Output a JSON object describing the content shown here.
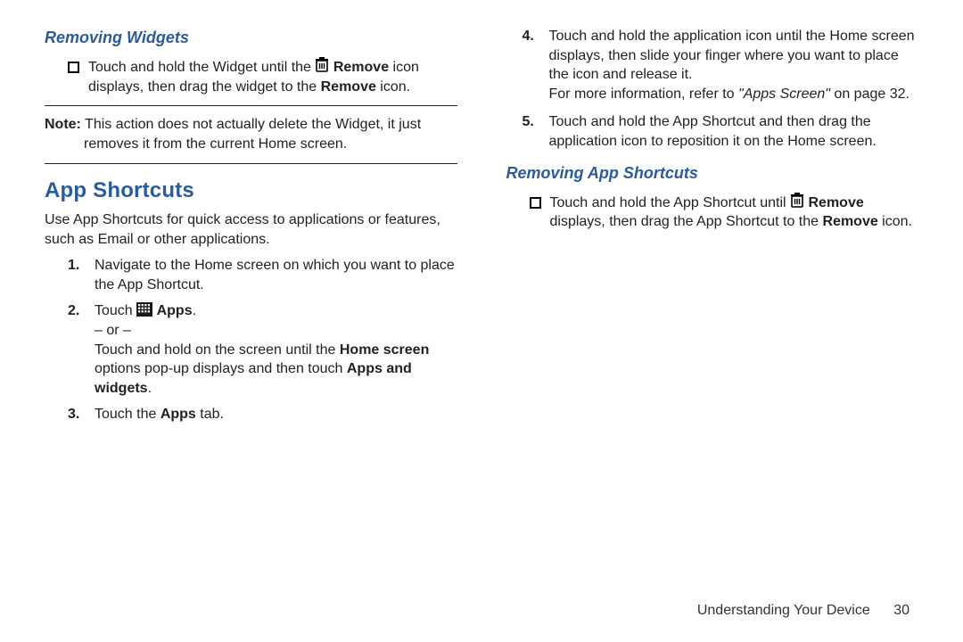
{
  "left": {
    "subheading1": "Removing Widgets",
    "bullet1_pre": "Touch and hold the Widget until the ",
    "bullet1_remove": "Remove",
    "bullet1_mid": " icon displays, then drag the widget to the ",
    "bullet1_remove2": "Remove",
    "bullet1_end": " icon.",
    "note_label": "Note:",
    "note_text_line1": " This action does not actually delete the Widget, it just",
    "note_text_line2": "removes it from the current Home screen.",
    "heading": "App Shortcuts",
    "intro": "Use App Shortcuts for quick access to applications or features, such as Email or other applications.",
    "step1_num": "1.",
    "step1": "Navigate to the Home screen on which you want to place the App Shortcut.",
    "step2_num": "2.",
    "step2_pre": "Touch ",
    "step2_apps": "Apps",
    "step2_dot": ".",
    "step2_or": "– or –",
    "step2_alt_pre": "Touch and hold on the screen until the ",
    "step2_alt_home": "Home screen",
    "step2_alt_mid": " options pop-up displays and then touch ",
    "step2_alt_appswidgets": "Apps and widgets",
    "step2_alt_end": ".",
    "step3_num": "3.",
    "step3_pre": "Touch the ",
    "step3_apps": "Apps",
    "step3_end": " tab."
  },
  "right": {
    "step4_num": "4.",
    "step4_a": "Touch and hold the application icon until the Home screen displays, then slide your finger where you want to place the icon and release it.",
    "step4_ref_pre": "For more information, refer to ",
    "step4_ref_ital": "\"Apps Screen\"",
    "step4_ref_end": " on page 32.",
    "step5_num": "5.",
    "step5": "Touch and hold the App Shortcut and then drag the application icon to reposition it on the Home screen.",
    "subheading2": "Removing App Shortcuts",
    "bullet2_pre": "Touch and hold the App Shortcut until ",
    "bullet2_remove": "Remove",
    "bullet2_mid": " displays, then drag the App Shortcut to the ",
    "bullet2_remove2": "Remove",
    "bullet2_end": " icon."
  },
  "footer": {
    "section": "Understanding Your Device",
    "page": "30"
  },
  "icons": {
    "trash": "trash-icon",
    "apps_grid": "apps-grid-icon"
  }
}
